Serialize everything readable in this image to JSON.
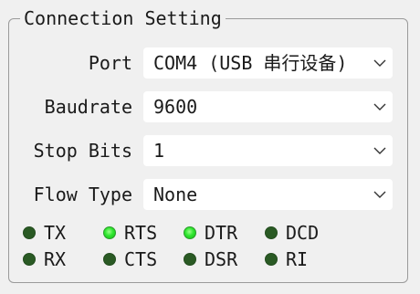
{
  "group": {
    "title": "Connection Setting"
  },
  "fields": {
    "port": {
      "label": "Port",
      "value": "COM4 (USB 串行设备)"
    },
    "baudrate": {
      "label": "Baudrate",
      "value": "9600"
    },
    "stop_bits": {
      "label": "Stop Bits",
      "value": "1"
    },
    "flow_type": {
      "label": "Flow Type",
      "value": "None"
    }
  },
  "indicators": {
    "tx": {
      "label": "TX",
      "state": "off"
    },
    "rts": {
      "label": "RTS",
      "state": "on"
    },
    "dtr": {
      "label": "DTR",
      "state": "on"
    },
    "dcd": {
      "label": "DCD",
      "state": "off"
    },
    "rx": {
      "label": "RX",
      "state": "off"
    },
    "cts": {
      "label": "CTS",
      "state": "off"
    },
    "dsr": {
      "label": "DSR",
      "state": "off"
    },
    "ri": {
      "label": "RI",
      "state": "off"
    }
  },
  "colors": {
    "led_on": "#2fe62f",
    "led_off": "#2a5a24",
    "background": "#f0f0f0",
    "border": "#9a9a9a"
  },
  "icons": {
    "dropdown": "chevron-down-icon"
  }
}
